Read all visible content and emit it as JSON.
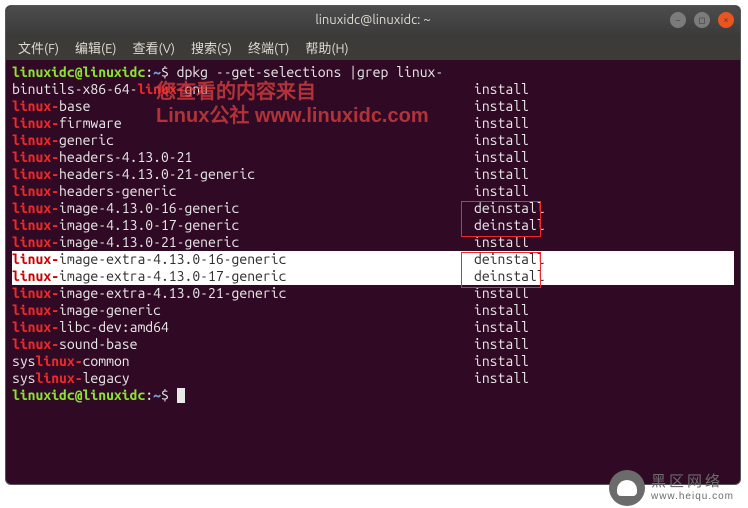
{
  "titlebar": {
    "title": "linuxidc@linuxidc: ~"
  },
  "menu": {
    "file": "文件(F)",
    "edit": "编辑(E)",
    "view": "查看(V)",
    "search": "搜索(S)",
    "terminal": "终端(T)",
    "help": "帮助(H)"
  },
  "prompt": {
    "userhost": "linuxidc@linuxidc",
    "sep": ":",
    "path": "~",
    "dollar": "$"
  },
  "command": "dpkg --get-selections |grep linux-",
  "rows": [
    {
      "parts": [
        "binutils-x86-64-",
        "linux-",
        "gnu"
      ],
      "status": "install",
      "hl": false
    },
    {
      "parts": [
        "",
        "linux-",
        "base"
      ],
      "status": "install",
      "hl": false
    },
    {
      "parts": [
        "",
        "linux-",
        "firmware"
      ],
      "status": "install",
      "hl": false
    },
    {
      "parts": [
        "",
        "linux-",
        "generic"
      ],
      "status": "install",
      "hl": false
    },
    {
      "parts": [
        "",
        "linux-",
        "headers-4.13.0-21"
      ],
      "status": "install",
      "hl": false
    },
    {
      "parts": [
        "",
        "linux-",
        "headers-4.13.0-21-generic"
      ],
      "status": "install",
      "hl": false
    },
    {
      "parts": [
        "",
        "linux-",
        "headers-generic"
      ],
      "status": "install",
      "hl": false
    },
    {
      "parts": [
        "",
        "linux-",
        "image-4.13.0-16-generic"
      ],
      "status": "deinstall",
      "hl": false
    },
    {
      "parts": [
        "",
        "linux-",
        "image-4.13.0-17-generic"
      ],
      "status": "deinstall",
      "hl": false
    },
    {
      "parts": [
        "",
        "linux-",
        "image-4.13.0-21-generic"
      ],
      "status": "install",
      "hl": false
    },
    {
      "parts": [
        "",
        "linux-",
        "image-extra-4.13.0-16-generic"
      ],
      "status": "deinstall",
      "hl": true
    },
    {
      "parts": [
        "",
        "linux-",
        "image-extra-4.13.0-17-generic"
      ],
      "status": "deinstall",
      "hl": true
    },
    {
      "parts": [
        "",
        "linux-",
        "image-extra-4.13.0-21-generic"
      ],
      "status": "install",
      "hl": false
    },
    {
      "parts": [
        "",
        "linux-",
        "image-generic"
      ],
      "status": "install",
      "hl": false
    },
    {
      "parts": [
        "",
        "linux-",
        "libc-dev:amd64"
      ],
      "status": "install",
      "hl": false
    },
    {
      "parts": [
        "",
        "linux-",
        "sound-base"
      ],
      "status": "install",
      "hl": false
    },
    {
      "parts": [
        "sys",
        "linux-",
        "common"
      ],
      "status": "install",
      "hl": false
    },
    {
      "parts": [
        "sys",
        "linux-",
        "legacy"
      ],
      "status": "install",
      "hl": false
    }
  ],
  "watermark": {
    "line1": "您查看的内容来自",
    "line2": "Linux公社 www.linuxidc.com"
  },
  "footer": {
    "name": "黑区网络",
    "domain": "www.heiqu.com"
  }
}
